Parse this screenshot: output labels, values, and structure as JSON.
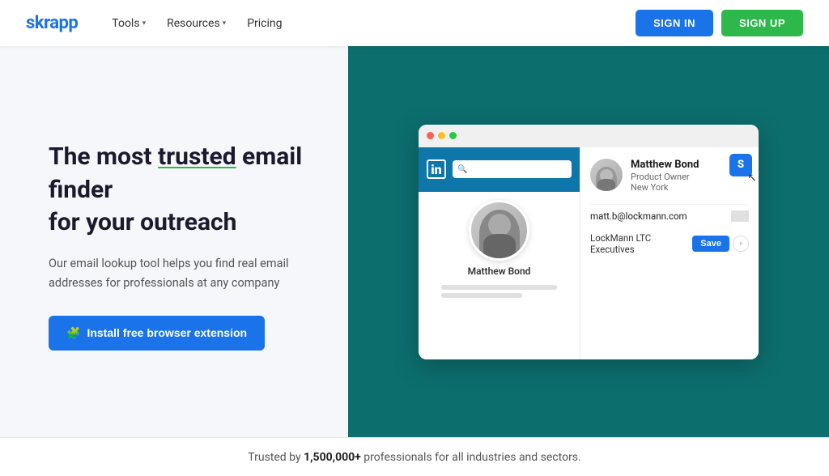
{
  "brand": {
    "logo": "skrapp"
  },
  "navbar": {
    "links": [
      {
        "label": "Tools",
        "has_dropdown": true
      },
      {
        "label": "Resources",
        "has_dropdown": true
      },
      {
        "label": "Pricing",
        "has_dropdown": false
      }
    ],
    "signin_label": "SIGN IN",
    "signup_label": "SIGN UP"
  },
  "hero": {
    "title_part1": "The most ",
    "title_underline": "trusted",
    "title_part2": " email finder",
    "title_line2": "for your outreach",
    "subtitle": "Our email lookup tool helps you find real email addresses for professionals at any company",
    "cta_label": "Install free browser extension",
    "cta_icon": "🧩"
  },
  "mockup": {
    "profile_name": "Matthew Bond",
    "contact_name": "Matthew Bond",
    "contact_title": "Product Owner",
    "contact_location": "New York",
    "email": "matt.b@lockmann.com",
    "list_name": "LockMann LTC Executives",
    "save_label": "Save",
    "skrapp_icon": "S"
  },
  "footer": {
    "text_before": "Trusted by ",
    "highlight": "1,500,000+",
    "text_after": " professionals for all industries and sectors."
  }
}
